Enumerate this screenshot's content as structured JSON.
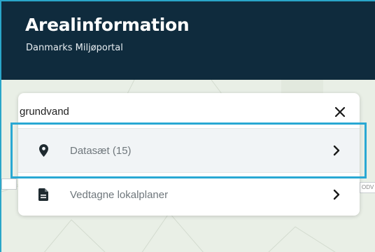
{
  "header": {
    "title": "Arealinformation",
    "subtitle": "Danmarks Miljøportal"
  },
  "search": {
    "value": "grundvand",
    "clear_icon": "close-icon"
  },
  "results": [
    {
      "label": "Datasæt (15)",
      "icon": "map-pin-icon",
      "active": true
    },
    {
      "label": "Vedtagne lokalplaner",
      "icon": "document-icon",
      "active": false
    }
  ],
  "map": {
    "road_label_right": "ODV"
  },
  "colors": {
    "header_bg": "#0f2b3d",
    "highlight": "#29a8d3",
    "map_bg": "#e9efe6"
  }
}
